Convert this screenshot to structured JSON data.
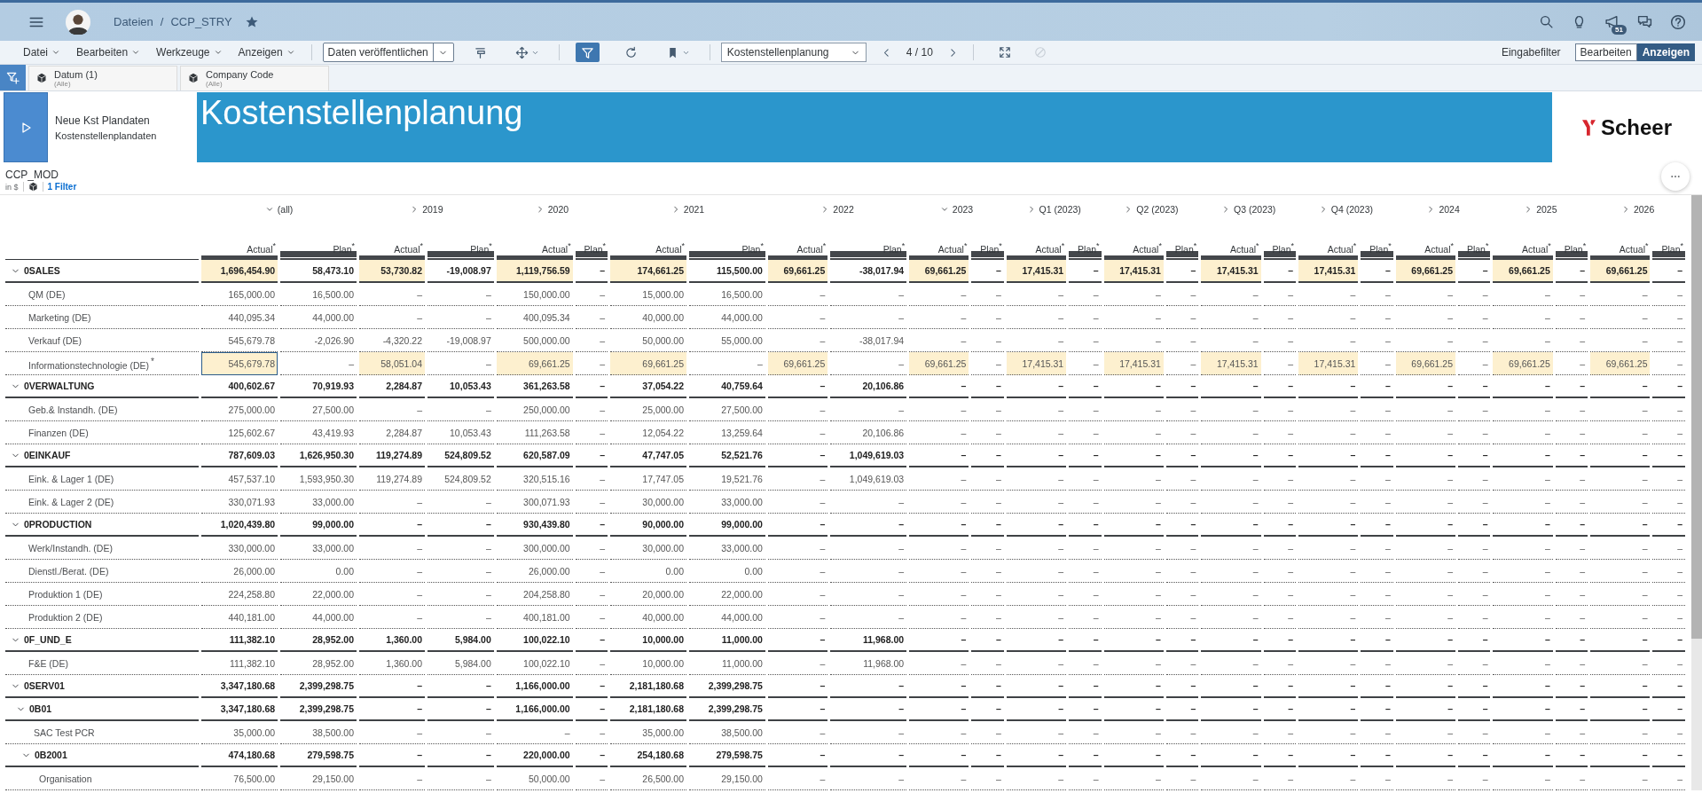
{
  "shell": {
    "breadcrumb": [
      "Dateien",
      "CCP_STRY"
    ],
    "breadcrumb_separator": "/",
    "favorite": true,
    "notifications_badge": "51"
  },
  "toolbar": {
    "menus": [
      "Datei",
      "Bearbeiten",
      "Werkzeuge",
      "Anzeigen"
    ],
    "publish_button": "Daten veröffentlichen",
    "tools": [
      {
        "kind": "format",
        "caret": false,
        "selected": false
      },
      {
        "kind": "move",
        "caret": true,
        "selected": false
      },
      {
        "kind": "filter",
        "caret": false,
        "selected": true
      },
      {
        "kind": "refresh",
        "caret": false,
        "selected": false
      },
      {
        "kind": "bookmark",
        "caret": true,
        "selected": false
      }
    ],
    "page_select": "Kostenstellenplanung",
    "page": "4 / 10",
    "end_tools": [
      {
        "kind": "fullscreen",
        "disabled": false
      },
      {
        "kind": "blocked",
        "disabled": true
      }
    ],
    "input_filter": "Eingabefilter",
    "modes": [
      {
        "label": "Bearbeiten",
        "selected": false
      },
      {
        "label": "Anzeigen",
        "selected": true
      }
    ]
  },
  "filters": [
    {
      "label": "Datum (1)",
      "value": "(Alle)"
    },
    {
      "label": "Company Code",
      "value": "(Alle)"
    }
  ],
  "banner": {
    "title": "Neue Kst Plandaten",
    "subtitle": "Kostenstellenplandaten",
    "heading": "Kostenstellenplanung",
    "logo": "Scheer"
  },
  "table": {
    "title": "CCP_MOD",
    "unit": "in $",
    "filter_link": "1 Filter",
    "column_groups": [
      {
        "label": "(all)",
        "expanded": true,
        "measures": [
          "Actual$^{*}$",
          "Plan$^{*}$"
        ]
      },
      {
        "label": "2019",
        "expanded": false,
        "measures": [
          "Actual$^{*}$",
          "Plan$^{*}$"
        ]
      },
      {
        "label": "2020",
        "expanded": false,
        "measures": [
          "Actual$^{*}$",
          "Plan$^{*}$"
        ]
      },
      {
        "label": "2021",
        "expanded": false,
        "measures": [
          "Actual$^{*}$",
          "Plan$^{*}$"
        ]
      },
      {
        "label": "2022",
        "expanded": false,
        "measures": [
          "Actual$^{*}$",
          "Plan$^{*}$"
        ]
      },
      {
        "label": "2023",
        "expanded": true,
        "measures": [
          "Actual$^{*}$",
          "Plan$^{*}$"
        ]
      },
      {
        "label": "Q1 (2023)",
        "expanded": false,
        "measures": [
          "Actual$^{*}$",
          "Plan$^{*}$"
        ]
      },
      {
        "label": "Q2 (2023)",
        "expanded": false,
        "measures": [
          "Actual$^{*}$",
          "Plan$^{*}$"
        ]
      },
      {
        "label": "Q3 (2023)",
        "expanded": false,
        "measures": [
          "Actual$^{*}$",
          "Plan$^{*}$"
        ]
      },
      {
        "label": "Q4 (2023)",
        "expanded": false,
        "measures": [
          "Actual$^{*}$",
          "Plan$^{*}$"
        ]
      },
      {
        "label": "2024",
        "expanded": false,
        "measures": [
          "Actual$^{*}$",
          "Plan$^{*}$"
        ]
      },
      {
        "label": "2025",
        "expanded": false,
        "measures": [
          "Actual$^{*}$",
          "Plan$^{*}$"
        ]
      },
      {
        "label": "2026",
        "expanded": false,
        "measures": [
          "Actual$^{*}$",
          "Plan$^{*}$"
        ]
      }
    ],
    "rows": [
      {
        "label": "0SALES",
        "expanded": true,
        "editable": true,
        "selected": false,
        "values": [
          "1,696,454.90",
          "58,473.10",
          "53,730.82",
          "-19,008.97",
          "1,119,756.59",
          "–",
          "174,661.25",
          "115,500.00",
          "69,661.25",
          "-38,017.94",
          "69,661.25",
          "–",
          "17,415.31",
          "–",
          "17,415.31",
          "–",
          "17,415.31",
          "–",
          "17,415.31",
          "–",
          "69,661.25",
          "–",
          "69,661.25",
          "–",
          "69,661.25",
          "–"
        ],
        "children": [
          {
            "label": "QM (DE)",
            "editable": false,
            "selected": false,
            "values": [
              "165,000.00",
              "16,500.00",
              "–",
              "–",
              "150,000.00",
              "–",
              "15,000.00",
              "16,500.00",
              "–",
              "–",
              "–",
              "–",
              "–",
              "–",
              "–",
              "–",
              "–",
              "–",
              "–",
              "–",
              "–",
              "–",
              "–",
              "–",
              "–",
              "–"
            ]
          },
          {
            "label": "Marketing (DE)",
            "editable": false,
            "selected": false,
            "values": [
              "440,095.34",
              "44,000.00",
              "–",
              "–",
              "400,095.34",
              "–",
              "40,000.00",
              "44,000.00",
              "–",
              "–",
              "–",
              "–",
              "–",
              "–",
              "–",
              "–",
              "–",
              "–",
              "–",
              "–",
              "–",
              "–",
              "–",
              "–",
              "–",
              "–"
            ]
          },
          {
            "label": "Verkauf (DE)",
            "editable": false,
            "selected": false,
            "values": [
              "545,679.78",
              "-2,026.90",
              "-4,320.22",
              "-19,008.97",
              "500,000.00",
              "–",
              "50,000.00",
              "55,000.00",
              "–",
              "-38,017.94",
              "–",
              "–",
              "–",
              "–",
              "–",
              "–",
              "–",
              "–",
              "–",
              "–",
              "–",
              "–",
              "–",
              "–",
              "–",
              "–"
            ]
          },
          {
            "label": "Informationstechnologie (DE)",
            "flag": "*",
            "editable": true,
            "selected": true,
            "values": [
              "545,679.78",
              "–",
              "58,051.04",
              "–",
              "69,661.25",
              "–",
              "69,661.25",
              "–",
              "69,661.25",
              "–",
              "69,661.25",
              "–",
              "17,415.31",
              "–",
              "17,415.31",
              "–",
              "17,415.31",
              "–",
              "17,415.31",
              "–",
              "69,661.25",
              "–",
              "69,661.25",
              "–",
              "69,661.25",
              "–"
            ]
          }
        ]
      },
      {
        "label": "0VERWALTUNG",
        "expanded": true,
        "editable": false,
        "selected": false,
        "values": [
          "400,602.67",
          "70,919.93",
          "2,284.87",
          "10,053.43",
          "361,263.58",
          "–",
          "37,054.22",
          "40,759.64",
          "–",
          "20,106.86",
          "–",
          "–",
          "–",
          "–",
          "–",
          "–",
          "–",
          "–",
          "–",
          "–",
          "–",
          "–",
          "–",
          "–",
          "–",
          "–"
        ],
        "children": [
          {
            "label": "Geb.& Instandh. (DE)",
            "editable": false,
            "selected": false,
            "values": [
              "275,000.00",
              "27,500.00",
              "–",
              "–",
              "250,000.00",
              "–",
              "25,000.00",
              "27,500.00",
              "–",
              "–",
              "–",
              "–",
              "–",
              "–",
              "–",
              "–",
              "–",
              "–",
              "–",
              "–",
              "–",
              "–",
              "–",
              "–",
              "–",
              "–"
            ]
          },
          {
            "label": "Finanzen (DE)",
            "editable": false,
            "selected": false,
            "values": [
              "125,602.67",
              "43,419.93",
              "2,284.87",
              "10,053.43",
              "111,263.58",
              "–",
              "12,054.22",
              "13,259.64",
              "–",
              "20,106.86",
              "–",
              "–",
              "–",
              "–",
              "–",
              "–",
              "–",
              "–",
              "–",
              "–",
              "–",
              "–",
              "–",
              "–",
              "–",
              "–"
            ]
          }
        ]
      },
      {
        "label": "0EINKAUF",
        "expanded": true,
        "editable": false,
        "selected": false,
        "values": [
          "787,609.03",
          "1,626,950.30",
          "119,274.89",
          "524,809.52",
          "620,587.09",
          "–",
          "47,747.05",
          "52,521.76",
          "–",
          "1,049,619.03",
          "–",
          "–",
          "–",
          "–",
          "–",
          "–",
          "–",
          "–",
          "–",
          "–",
          "–",
          "–",
          "–",
          "–",
          "–",
          "–"
        ],
        "children": [
          {
            "label": "Eink. & Lager 1 (DE)",
            "editable": false,
            "selected": false,
            "values": [
              "457,537.10",
              "1,593,950.30",
              "119,274.89",
              "524,809.52",
              "320,515.16",
              "–",
              "17,747.05",
              "19,521.76",
              "–",
              "1,049,619.03",
              "–",
              "–",
              "–",
              "–",
              "–",
              "–",
              "–",
              "–",
              "–",
              "–",
              "–",
              "–",
              "–",
              "–",
              "–",
              "–"
            ]
          },
          {
            "label": "Eink. & Lager 2 (DE)",
            "editable": false,
            "selected": false,
            "values": [
              "330,071.93",
              "33,000.00",
              "–",
              "–",
              "300,071.93",
              "–",
              "30,000.00",
              "33,000.00",
              "–",
              "–",
              "–",
              "–",
              "–",
              "–",
              "–",
              "–",
              "–",
              "–",
              "–",
              "–",
              "–",
              "–",
              "–",
              "–",
              "–",
              "–"
            ]
          }
        ]
      },
      {
        "label": "0PRODUCTION",
        "expanded": true,
        "editable": false,
        "selected": false,
        "values": [
          "1,020,439.80",
          "99,000.00",
          "–",
          "–",
          "930,439.80",
          "–",
          "90,000.00",
          "99,000.00",
          "–",
          "–",
          "–",
          "–",
          "–",
          "–",
          "–",
          "–",
          "–",
          "–",
          "–",
          "–",
          "–",
          "–",
          "–",
          "–",
          "–",
          "–"
        ],
        "children": [
          {
            "label": "Werk/Instandh. (DE)",
            "editable": false,
            "selected": false,
            "values": [
              "330,000.00",
              "33,000.00",
              "–",
              "–",
              "300,000.00",
              "–",
              "30,000.00",
              "33,000.00",
              "–",
              "–",
              "–",
              "–",
              "–",
              "–",
              "–",
              "–",
              "–",
              "–",
              "–",
              "–",
              "–",
              "–",
              "–",
              "–",
              "–",
              "–"
            ]
          },
          {
            "label": "Dienstl./Berat. (DE)",
            "editable": false,
            "selected": false,
            "values": [
              "26,000.00",
              "0.00",
              "–",
              "–",
              "26,000.00",
              "–",
              "0.00",
              "0.00",
              "–",
              "–",
              "–",
              "–",
              "–",
              "–",
              "–",
              "–",
              "–",
              "–",
              "–",
              "–",
              "–",
              "–",
              "–",
              "–",
              "–",
              "–"
            ]
          },
          {
            "label": "Produktion 1 (DE)",
            "editable": false,
            "selected": false,
            "values": [
              "224,258.80",
              "22,000.00",
              "–",
              "–",
              "204,258.80",
              "–",
              "20,000.00",
              "22,000.00",
              "–",
              "–",
              "–",
              "–",
              "–",
              "–",
              "–",
              "–",
              "–",
              "–",
              "–",
              "–",
              "–",
              "–",
              "–",
              "–",
              "–",
              "–"
            ]
          },
          {
            "label": "Produktion 2 (DE)",
            "editable": false,
            "selected": false,
            "values": [
              "440,181.00",
              "44,000.00",
              "–",
              "–",
              "400,181.00",
              "–",
              "40,000.00",
              "44,000.00",
              "–",
              "–",
              "–",
              "–",
              "–",
              "–",
              "–",
              "–",
              "–",
              "–",
              "–",
              "–",
              "–",
              "–",
              "–",
              "–",
              "–",
              "–"
            ]
          }
        ]
      },
      {
        "label": "0F_UND_E",
        "expanded": true,
        "editable": false,
        "selected": false,
        "values": [
          "111,382.10",
          "28,952.00",
          "1,360.00",
          "5,984.00",
          "100,022.10",
          "–",
          "10,000.00",
          "11,000.00",
          "–",
          "11,968.00",
          "–",
          "–",
          "–",
          "–",
          "–",
          "–",
          "–",
          "–",
          "–",
          "–",
          "–",
          "–",
          "–",
          "–",
          "–",
          "–"
        ],
        "children": [
          {
            "label": "F&E (DE)",
            "editable": false,
            "selected": false,
            "values": [
              "111,382.10",
              "28,952.00",
              "1,360.00",
              "5,984.00",
              "100,022.10",
              "–",
              "10,000.00",
              "11,000.00",
              "–",
              "11,968.00",
              "–",
              "–",
              "–",
              "–",
              "–",
              "–",
              "–",
              "–",
              "–",
              "–",
              "–",
              "–",
              "–",
              "–",
              "–",
              "–"
            ]
          }
        ]
      },
      {
        "label": "0SERV01",
        "expanded": true,
        "editable": false,
        "selected": false,
        "values": [
          "3,347,180.68",
          "2,399,298.75",
          "–",
          "–",
          "1,166,000.00",
          "–",
          "2,181,180.68",
          "2,399,298.75",
          "–",
          "–",
          "–",
          "–",
          "–",
          "–",
          "–",
          "–",
          "–",
          "–",
          "–",
          "–",
          "–",
          "–",
          "–",
          "–",
          "–",
          "–"
        ],
        "children": [
          {
            "label": "0B01",
            "expanded": true,
            "editable": false,
            "selected": false,
            "values": [
              "3,347,180.68",
              "2,399,298.75",
              "–",
              "–",
              "1,166,000.00",
              "–",
              "2,181,180.68",
              "2,399,298.75",
              "–",
              "–",
              "–",
              "–",
              "–",
              "–",
              "–",
              "–",
              "–",
              "–",
              "–",
              "–",
              "–",
              "–",
              "–",
              "–",
              "–",
              "–"
            ],
            "children": [
              {
                "label": "SAC Test PCR",
                "editable": false,
                "selected": false,
                "values": [
                  "35,000.00",
                  "38,500.00",
                  "–",
                  "–",
                  "–",
                  "–",
                  "35,000.00",
                  "38,500.00",
                  "–",
                  "–",
                  "–",
                  "–",
                  "–",
                  "–",
                  "–",
                  "–",
                  "–",
                  "–",
                  "–",
                  "–",
                  "–",
                  "–",
                  "–",
                  "–",
                  "–",
                  "–"
                ]
              },
              {
                "label": "0B2001",
                "expanded": true,
                "editable": false,
                "selected": false,
                "values": [
                  "474,180.68",
                  "279,598.75",
                  "–",
                  "–",
                  "220,000.00",
                  "–",
                  "254,180.68",
                  "279,598.75",
                  "–",
                  "–",
                  "–",
                  "–",
                  "–",
                  "–",
                  "–",
                  "–",
                  "–",
                  "–",
                  "–",
                  "–",
                  "–",
                  "–",
                  "–",
                  "–",
                  "–",
                  "–"
                ],
                "children": [
                  {
                    "label": "Organisation",
                    "editable": false,
                    "selected": false,
                    "values": [
                      "76,500.00",
                      "29,150.00",
                      "–",
                      "–",
                      "50,000.00",
                      "–",
                      "26,500.00",
                      "29,150.00",
                      "–",
                      "–",
                      "–",
                      "–",
                      "–",
                      "–",
                      "–",
                      "–",
                      "–",
                      "–",
                      "–",
                      "–",
                      "–",
                      "–",
                      "–",
                      "–",
                      "–",
                      "–"
                    ]
                  }
                ]
              }
            ]
          }
        ]
      }
    ]
  }
}
